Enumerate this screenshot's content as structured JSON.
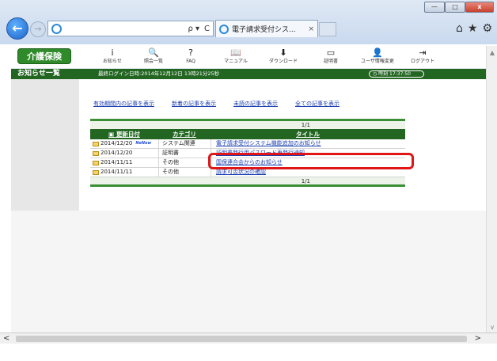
{
  "browser": {
    "tab_title": "電子請求受付シス...",
    "tab_close": "×",
    "win_minimize": "—",
    "win_maximize": "□",
    "win_close": "x",
    "back": "←",
    "forward": "→",
    "addr_search": "ρ ▾",
    "addr_refresh": "C",
    "home_icon": "⌂",
    "fav_icon": "★",
    "settings_icon": "⚙"
  },
  "header": {
    "brand": "介護保険",
    "tools": [
      {
        "label": "お知らせ",
        "icon": "i"
      },
      {
        "label": "照会一覧",
        "icon": "🔍"
      },
      {
        "label": "FAQ",
        "icon": "?"
      },
      {
        "label": "マニュアル",
        "icon": "📖"
      },
      {
        "label": "ダウンロード",
        "icon": "⬇"
      },
      {
        "label": "証明書",
        "icon": "▭"
      },
      {
        "label": "ユーザ情報変更",
        "icon": "👤"
      },
      {
        "label": "ログアウト",
        "icon": "⇥"
      }
    ]
  },
  "notice_bar": {
    "title": "お知らせ一覧",
    "last_login": "最終ログイン日時:2014年12月12日 13時21分25秒",
    "clock": "◷ 時刻 17:37:50"
  },
  "filters": [
    "有効期間内の記事を表示",
    "新着の記事を表示",
    "未読の記事を表示",
    "全ての記事を表示"
  ],
  "table": {
    "pager_top": "1/1",
    "pager_bottom": "1/1",
    "headers": {
      "date": "▣ 更新日付",
      "category": "カテゴリ",
      "title": "タイトル"
    },
    "rows": [
      {
        "date": "2014/12/20",
        "new_badge": "NeNew",
        "category": "システム関連",
        "title": "電子請求受付システム機能追加のお知らせ"
      },
      {
        "date": "2014/12/20",
        "new_badge": "",
        "category": "証明書",
        "title": "証明書発行用パスワード再発行通知"
      },
      {
        "date": "2014/11/11",
        "new_badge": "",
        "category": "その他",
        "title": "国保連合会からのお知らせ"
      },
      {
        "date": "2014/11/11",
        "new_badge": "",
        "category": "その他",
        "title": "請求可否状況の確認"
      }
    ]
  },
  "scroll": {
    "up": "▲",
    "down": "∨",
    "left": "<",
    "right": ">"
  },
  "colors": {
    "accent_green": "#236622",
    "highlight_red": "#e01515",
    "link_blue": "#1c3fb0"
  }
}
